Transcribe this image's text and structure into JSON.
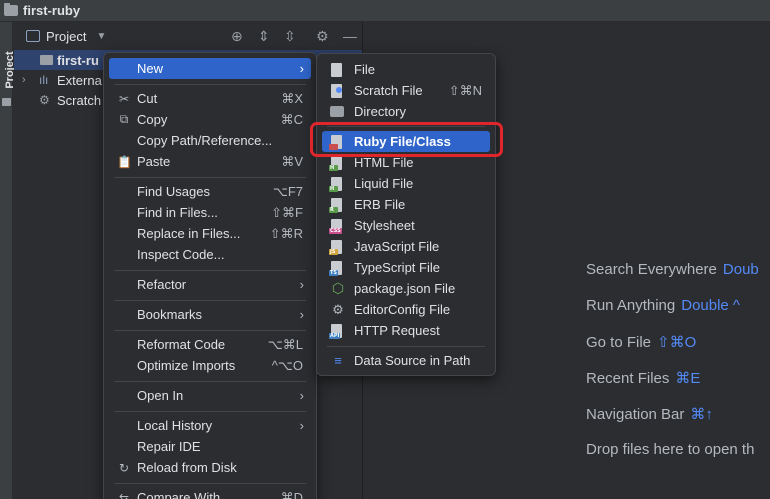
{
  "window": {
    "title": "first-ruby"
  },
  "stripe": {
    "label": "Project"
  },
  "panel": {
    "title": "Project",
    "tree": [
      "first-ru",
      "Externa",
      "Scratch"
    ]
  },
  "welcome": {
    "hints": [
      {
        "label": "Search Everywhere",
        "key": "Doub"
      },
      {
        "label": "Run Anything",
        "key": "Double ^"
      },
      {
        "label": "Go to File",
        "key": "⇧⌘O"
      },
      {
        "label": "Recent Files",
        "key": "⌘E"
      },
      {
        "label": "Navigation Bar",
        "key": "⌘↑"
      },
      {
        "label": "Drop files here to open th",
        "key": ""
      }
    ]
  },
  "context_menu": {
    "items": [
      {
        "label": "New",
        "icon": "",
        "shortcut": "",
        "submenu": true
      },
      {
        "label": "Cut",
        "icon": "scissors-icon",
        "shortcut": "⌘X"
      },
      {
        "label": "Copy",
        "icon": "copy-icon",
        "shortcut": "⌘C"
      },
      {
        "label": "Copy Path/Reference...",
        "icon": "",
        "shortcut": ""
      },
      {
        "label": "Paste",
        "icon": "clipboard-icon",
        "shortcut": "⌘V"
      },
      {
        "label": "Find Usages",
        "icon": "",
        "shortcut": "⌥F7"
      },
      {
        "label": "Find in Files...",
        "icon": "",
        "shortcut": "⇧⌘F"
      },
      {
        "label": "Replace in Files...",
        "icon": "",
        "shortcut": "⇧⌘R"
      },
      {
        "label": "Inspect Code...",
        "icon": "",
        "shortcut": ""
      },
      {
        "label": "Refactor",
        "icon": "",
        "shortcut": "",
        "submenu": true
      },
      {
        "label": "Bookmarks",
        "icon": "",
        "shortcut": "",
        "submenu": true
      },
      {
        "label": "Reformat Code",
        "icon": "",
        "shortcut": "⌥⌘L"
      },
      {
        "label": "Optimize Imports",
        "icon": "",
        "shortcut": "^⌥O"
      },
      {
        "label": "Open In",
        "icon": "",
        "shortcut": "",
        "submenu": true
      },
      {
        "label": "Local History",
        "icon": "",
        "shortcut": "",
        "submenu": true
      },
      {
        "label": "Repair IDE",
        "icon": "",
        "shortcut": ""
      },
      {
        "label": "Reload from Disk",
        "icon": "reload-icon",
        "shortcut": ""
      },
      {
        "label": "Compare With...",
        "icon": "compare-icon",
        "shortcut": "⌘D"
      }
    ]
  },
  "new_submenu": {
    "items": [
      {
        "label": "File",
        "icon": "file-icon",
        "shortcut": ""
      },
      {
        "label": "Scratch File",
        "icon": "scratch-file-icon",
        "shortcut": "⇧⌘N"
      },
      {
        "label": "Directory",
        "icon": "folder-icon",
        "shortcut": ""
      },
      {
        "label": "Ruby File/Class",
        "icon": "ruby-file-icon",
        "shortcut": ""
      },
      {
        "label": "HTML File",
        "icon": "html-file-icon",
        "shortcut": ""
      },
      {
        "label": "Liquid File",
        "icon": "liquid-file-icon",
        "shortcut": ""
      },
      {
        "label": "ERB File",
        "icon": "erb-file-icon",
        "shortcut": ""
      },
      {
        "label": "Stylesheet",
        "icon": "css-file-icon",
        "shortcut": ""
      },
      {
        "label": "JavaScript File",
        "icon": "js-file-icon",
        "shortcut": ""
      },
      {
        "label": "TypeScript File",
        "icon": "ts-file-icon",
        "shortcut": ""
      },
      {
        "label": "package.json File",
        "icon": "npm-icon",
        "shortcut": ""
      },
      {
        "label": "EditorConfig File",
        "icon": "gear-icon",
        "shortcut": ""
      },
      {
        "label": "HTTP Request",
        "icon": "api-file-icon",
        "shortcut": ""
      },
      {
        "label": "Data Source in Path",
        "icon": "database-icon",
        "shortcut": ""
      }
    ]
  },
  "colors": {
    "accent": "#2f65ca",
    "highlight_frame": "#e0262d",
    "link": "#548af7"
  }
}
